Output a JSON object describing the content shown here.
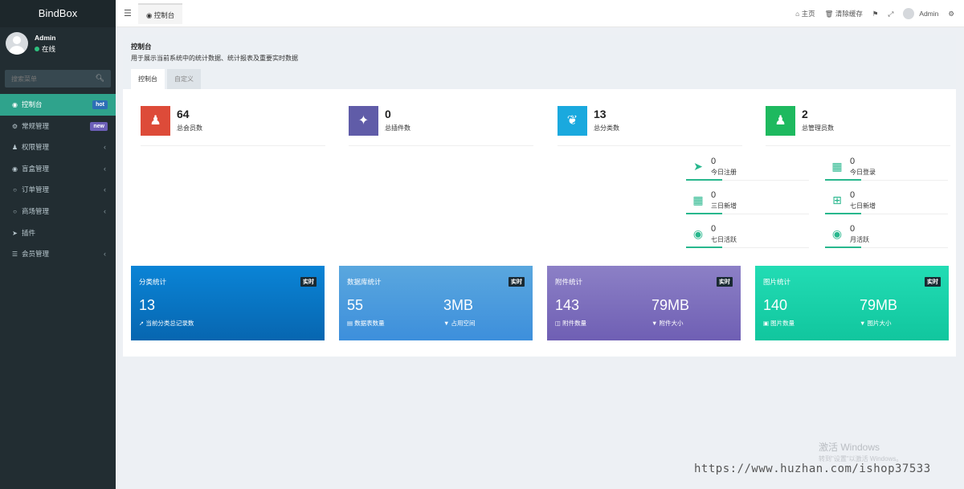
{
  "app": {
    "brand": "BindBox"
  },
  "user": {
    "name": "Admin",
    "status": "在线"
  },
  "search": {
    "placeholder": "搜索菜单"
  },
  "sidebar": {
    "items": [
      {
        "label": "控制台",
        "icon": "dashboard-icon",
        "badge": "hot",
        "active": true
      },
      {
        "label": "常规管理",
        "icon": "cogs-icon",
        "badge": "new"
      },
      {
        "label": "权限管理",
        "icon": "users-icon",
        "caret": "‹"
      },
      {
        "label": "盲盒管理",
        "icon": "shield-icon",
        "caret": "‹"
      },
      {
        "label": "订单管理",
        "icon": "circle-icon",
        "caret": "‹"
      },
      {
        "label": "商场管理",
        "icon": "circle-icon",
        "caret": "‹"
      },
      {
        "label": "插件",
        "icon": "rocket-icon"
      },
      {
        "label": "会员管理",
        "icon": "list-icon",
        "caret": "‹"
      }
    ]
  },
  "header": {
    "tab": "控制台",
    "home": "主页",
    "clear_cache": "清除缓存",
    "user": "Admin"
  },
  "page": {
    "title": "控制台",
    "subtitle": "用于展示当前系统中的统计数据、统计报表及重要实时数据",
    "tabs": [
      "控制台",
      "自定义"
    ]
  },
  "stats": [
    {
      "value": "64",
      "label": "总会员数",
      "color": "#dd4b39",
      "icon": "users-icon"
    },
    {
      "value": "0",
      "label": "总插件数",
      "color": "#605ca8",
      "icon": "magic-icon"
    },
    {
      "value": "13",
      "label": "总分类数",
      "color": "#00c0ef",
      "icon": "leaf-icon"
    },
    {
      "value": "2",
      "label": "总管理员数",
      "color": "#00a65a",
      "icon": "user-icon"
    }
  ],
  "mini_stats": [
    {
      "value": "0",
      "label": "今日注册",
      "icon": "rocket-icon"
    },
    {
      "value": "0",
      "label": "今日登录",
      "icon": "vcard-icon"
    },
    {
      "value": "0",
      "label": "三日新增",
      "icon": "calendar-icon"
    },
    {
      "value": "0",
      "label": "七日新增",
      "icon": "calendar-plus-icon"
    },
    {
      "value": "0",
      "label": "七日活跃",
      "icon": "user-circle-icon"
    },
    {
      "value": "0",
      "label": "月活跃",
      "icon": "user-circle-icon"
    }
  ],
  "cards": [
    {
      "title": "分类统计",
      "tag": "实时",
      "v1": "13",
      "l1": "当前分类总记录数",
      "v2": "",
      "l2": "",
      "gradient": [
        "#0a84d6",
        "#0766b0"
      ]
    },
    {
      "title": "数据库统计",
      "tag": "实时",
      "v1": "55",
      "l1": "数据表数量",
      "v2": "3MB",
      "l2": "占用空间",
      "gradient": [
        "#5aa7de",
        "#3d8fdc"
      ]
    },
    {
      "title": "附件统计",
      "tag": "实时",
      "v1": "143",
      "l1": "附件数量",
      "v2": "79MB",
      "l2": "附件大小",
      "gradient": [
        "#8c80c6",
        "#6f5fb4"
      ]
    },
    {
      "title": "图片统计",
      "tag": "实时",
      "v1": "140",
      "l1": "图片数量",
      "v2": "79MB",
      "l2": "图片大小",
      "gradient": [
        "#22dcb4",
        "#11c69e"
      ]
    }
  ],
  "watermark": {
    "line1": "激活 Windows",
    "line2": "转到\"设置\"以激活 Windows。",
    "url": "https://www.huzhan.com/ishop37533"
  }
}
